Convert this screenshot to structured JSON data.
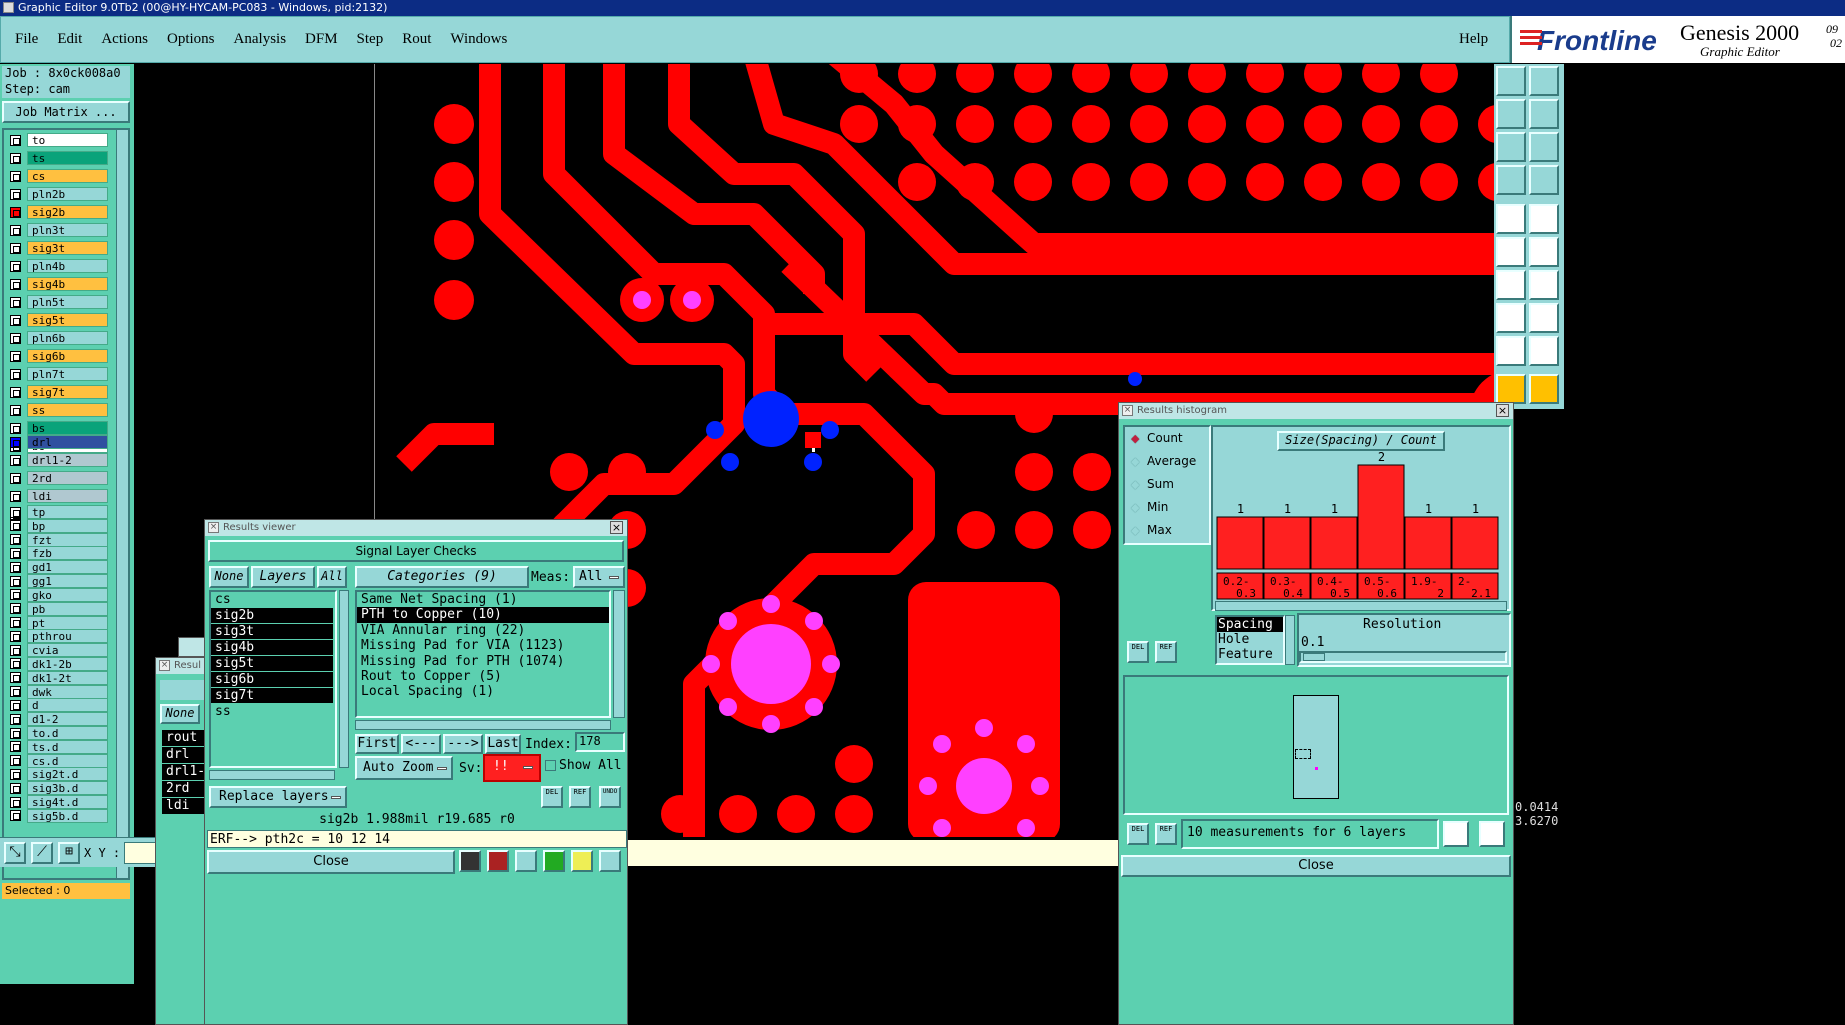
{
  "window": {
    "title": "Graphic Editor 9.0Tb2 (00@HY-HYCAM-PC083 - Windows, pid:2132)"
  },
  "menu": [
    "File",
    "Edit",
    "Actions",
    "Options",
    "Analysis",
    "DFM",
    "Step",
    "Rout",
    "Windows"
  ],
  "help": "Help",
  "brand": {
    "logo": "Frontline",
    "product": "Genesis 2000",
    "sub": "Graphic Editor",
    "date1": "09",
    "date2": "02"
  },
  "left": {
    "job": "Job : 8x0ck008a0",
    "step": "Step: cam",
    "job_matrix": "Job Matrix ...",
    "selected": "Selected : 0"
  },
  "layers_a": [
    {
      "name": "to",
      "color": "#ffffff",
      "sw": ""
    },
    {
      "name": "ts",
      "color": "#0aa37a",
      "sw": ""
    },
    {
      "name": "cs",
      "color": "#ffc040",
      "sw": ""
    },
    {
      "name": "pln2b",
      "color": "#96d7d7",
      "sw": ""
    },
    {
      "name": "sig2b",
      "color": "#ffc040",
      "sw": "#ff0000"
    },
    {
      "name": "pln3t",
      "color": "#96d7d7",
      "sw": ""
    },
    {
      "name": "sig3t",
      "color": "#ffc040",
      "sw": ""
    },
    {
      "name": "pln4b",
      "color": "#96d7d7",
      "sw": ""
    },
    {
      "name": "sig4b",
      "color": "#ffc040",
      "sw": ""
    },
    {
      "name": "pln5t",
      "color": "#96d7d7",
      "sw": ""
    },
    {
      "name": "sig5t",
      "color": "#ffc040",
      "sw": ""
    },
    {
      "name": "pln6b",
      "color": "#96d7d7",
      "sw": ""
    },
    {
      "name": "sig6b",
      "color": "#ffc040",
      "sw": ""
    },
    {
      "name": "pln7t",
      "color": "#96d7d7",
      "sw": ""
    },
    {
      "name": "sig7t",
      "color": "#ffc040",
      "sw": ""
    },
    {
      "name": "ss",
      "color": "#ffc040",
      "sw": ""
    },
    {
      "name": "bs",
      "color": "#0aa37a",
      "sw": ""
    },
    {
      "name": "bo",
      "color": "#ffffff",
      "sw": ""
    }
  ],
  "layers_b": [
    {
      "name": "drl",
      "color": "#3050a0",
      "sw": "#0000ff"
    },
    {
      "name": "drl1-2",
      "color": "#b0c8d0",
      "sw": ""
    },
    {
      "name": "2rd",
      "color": "#b0c8d0",
      "sw": ""
    },
    {
      "name": "ldi",
      "color": "#b0c8d0",
      "sw": ""
    },
    {
      "name": "rout",
      "color": "#d0e0e0",
      "sw": ""
    }
  ],
  "layers_c": [
    "tp",
    "bp",
    "fzt",
    "fzb",
    "gd1",
    "gg1",
    "gko",
    "pb",
    "pt",
    "pthrou",
    "cvia",
    "dk1-2b",
    "dk1-2t",
    "dwk",
    "d",
    "d1-2",
    "to.d",
    "ts.d",
    "cs.d",
    "sig2t.d",
    "sig3b.d",
    "sig4t.d",
    "sig5b.d"
  ],
  "bottom": {
    "xy": "X Y :"
  },
  "results_viewer": {
    "title": "Results viewer",
    "header": "Signal Layer Checks",
    "none": "None",
    "layers": "Layers",
    "all": "All",
    "categories_btn": "Categories (9)",
    "meas": "Meas:",
    "meas_val": "All",
    "layer_list": [
      "cs",
      "sig2b",
      "sig3t",
      "sig4b",
      "sig5t",
      "sig6b",
      "sig7t",
      "ss"
    ],
    "cat_list": [
      "Same Net Spacing (1)",
      "PTH to Copper (10)",
      "VIA Annular ring (22)",
      "Missing Pad for VIA (1123)",
      "Missing Pad for PTH (1074)",
      "Rout to Copper (5)",
      "Local Spacing (1)"
    ],
    "first": "First",
    "prev": "<---",
    "next": "--->",
    "last": "Last",
    "index_label": "Index:",
    "index_val": "178",
    "auto_zoom": "Auto Zoom",
    "sv": "Sv:",
    "sv_val": "!!",
    "show_all": "Show All",
    "replace": "Replace layers",
    "status": "sig2b 1.988mil   r19.685  r0",
    "erf": "ERF--> pth2c = 10 12 14",
    "close": "Close",
    "del": "DEL",
    "ref": "REF",
    "undo": "UNDO"
  },
  "back_window": {
    "title": "Resul",
    "none": "None",
    "items": [
      "rout",
      "drl",
      "drl1-",
      "2rd",
      "ldi"
    ]
  },
  "histogram": {
    "title": "Results histogram",
    "modes": [
      "Count",
      "Average",
      "Sum",
      "Min",
      "Max"
    ],
    "chart_title": "Size(Spacing) / Count",
    "spacing": "Spacing",
    "hole": "Hole",
    "feature": "Feature",
    "resolution": "Resolution",
    "res_val": "0.1",
    "footer": "10 measurements for 6 layers",
    "close": "Close",
    "del": "DEL",
    "ref": "REF"
  },
  "chart_data": {
    "type": "bar",
    "title": "Size(Spacing) / Count",
    "categories": [
      "0.2-0.3",
      "0.3-0.4",
      "0.4-0.5",
      "0.5-0.6",
      "1.9-2",
      "2-2.1"
    ],
    "values": [
      1,
      1,
      1,
      2,
      1,
      1
    ],
    "ylim": [
      0,
      2
    ],
    "color": "#ff2020"
  },
  "right_readout": {
    "a": "0.0414",
    "b": "3.6270"
  }
}
